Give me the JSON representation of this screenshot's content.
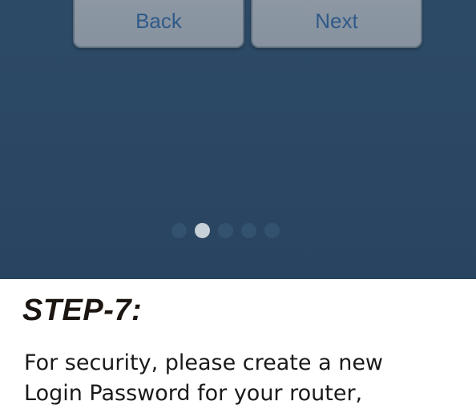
{
  "navigation": {
    "back_label": "Back",
    "next_label": "Next"
  },
  "pager": {
    "total": 5,
    "active_index": 1
  },
  "step": {
    "title": "STEP-7:",
    "description_lines": [
      "For security, please create a new",
      "Login Password for your router,"
    ]
  },
  "colors": {
    "screen_background": "#2b4763",
    "button_background": "#8d98a3",
    "button_text": "#2f5a88",
    "active_dot": "#c8d0d8",
    "inactive_dot": "#32526f"
  }
}
